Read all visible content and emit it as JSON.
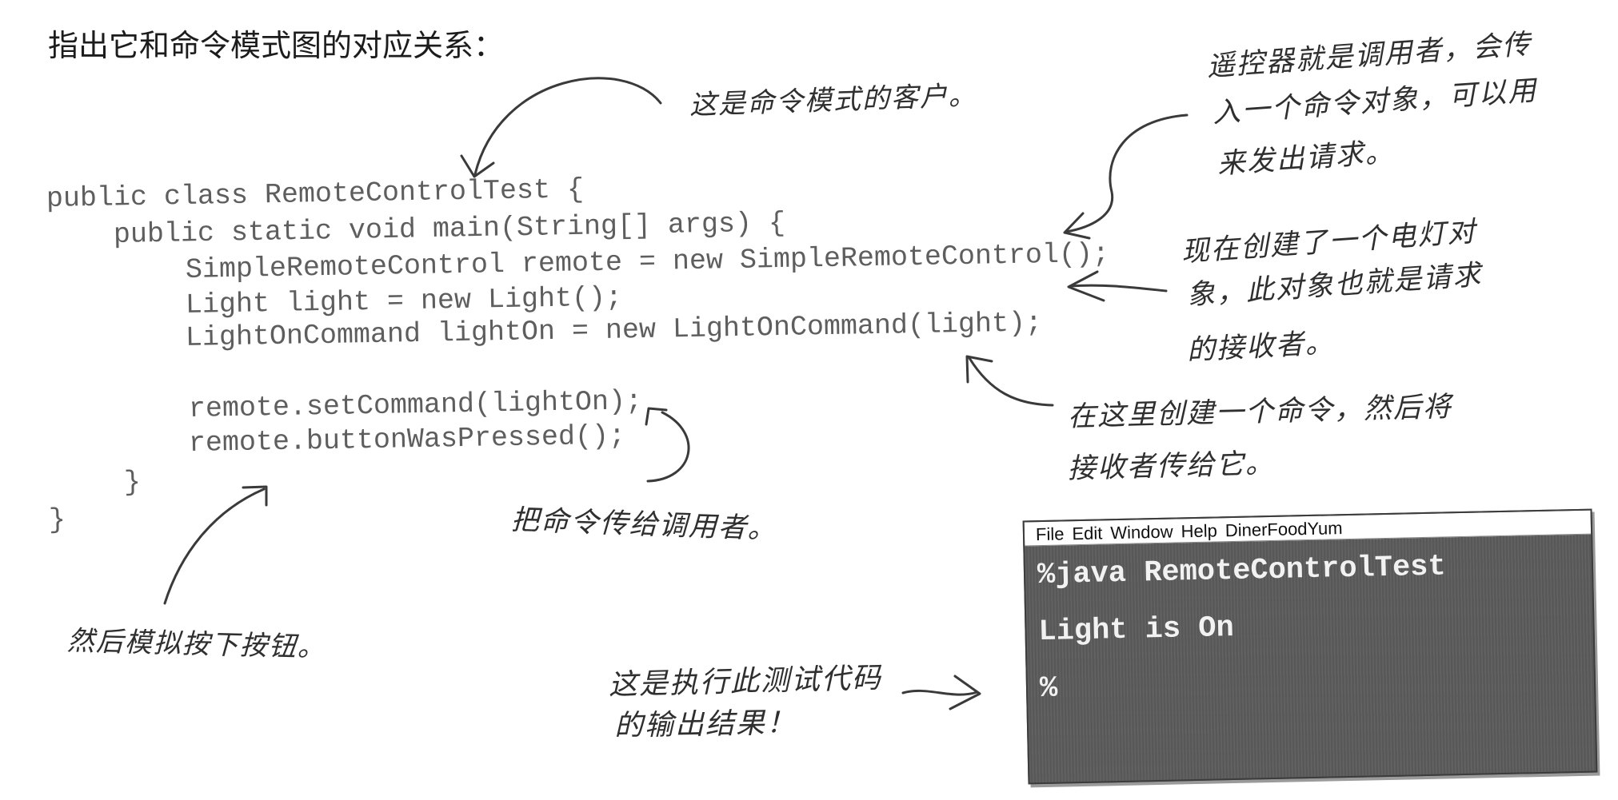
{
  "page": {
    "heading": "指出它和命令模式图的对应关系："
  },
  "code": {
    "lines": [
      "public class RemoteControlTest {",
      "public static void main(String[] args) {",
      "SimpleRemoteControl remote = new SimpleRemoteControl();",
      "Light light = new Light();",
      "LightOnCommand lightOn = new LightOnCommand(light);",
      "remote.setCommand(lightOn);",
      "remote.buttonWasPressed();",
      "}",
      "}"
    ]
  },
  "annotations": {
    "client": "这是命令模式的客户。",
    "invoker": [
      "遥控器就是调用者，会传",
      "入一个命令对象，可以用",
      "来发出请求。"
    ],
    "receiver": [
      "现在创建了一个电灯对",
      "象，此对象也就是请求",
      "的接收者。"
    ],
    "command": [
      "在这里创建一个命令，然后将",
      "接收者传给它。"
    ],
    "pass_command": "把命令传给调用者。",
    "press_button": "然后模拟按下按钮。",
    "output": [
      "这是执行此测试代码",
      "的输出结果！"
    ]
  },
  "terminal": {
    "menu": [
      "File",
      "Edit",
      "Window",
      "Help",
      "DinerFoodYum"
    ],
    "lines": [
      "%java RemoteControlTest",
      "Light is On",
      "%"
    ]
  }
}
